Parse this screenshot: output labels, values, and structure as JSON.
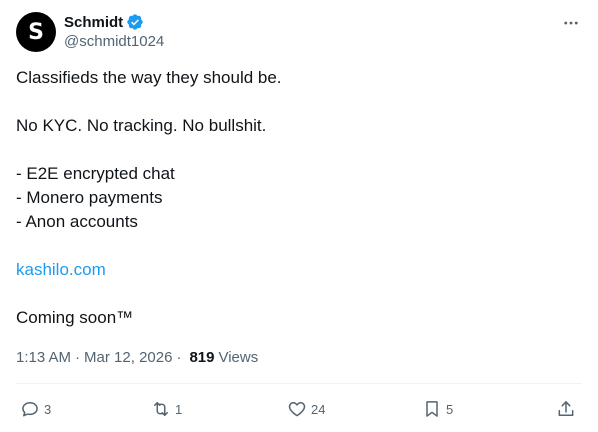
{
  "author": {
    "avatar_letter": "S",
    "display_name": "Schmidt",
    "handle": "@schmidt1024",
    "verified": true
  },
  "menu": {
    "more_icon": "more-horizontal-icon"
  },
  "post": {
    "line1": "Classifieds the way they should be.",
    "line2": "No KYC. No tracking. No bullshit.",
    "line3": "- E2E encrypted chat",
    "line4": "- Monero payments",
    "line5": "- Anon accounts",
    "link": "kashilo.com",
    "line6": "Coming soon™"
  },
  "meta": {
    "time": "1:13 AM",
    "separator1": "·",
    "date": "Mar 12, 2026",
    "separator2": "·",
    "views_count": "819",
    "views_label": "Views"
  },
  "actions": {
    "reply_count": "3",
    "retweet_count": "1",
    "like_count": "24",
    "bookmark_count": "5"
  },
  "colors": {
    "text": "#0f1419",
    "secondary": "#536471",
    "link": "#1d9bf0",
    "verified": "#1d9bf0",
    "divider": "#eff3f4"
  }
}
